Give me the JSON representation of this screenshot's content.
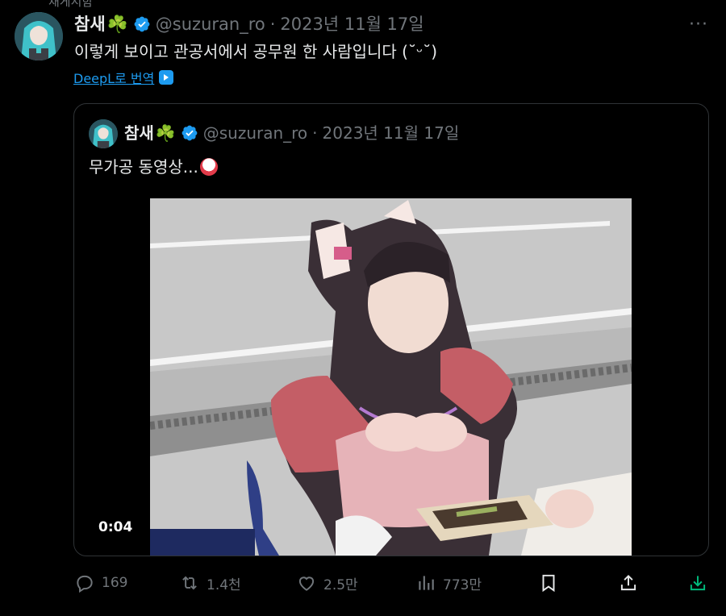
{
  "context_label": "재게시함",
  "tweet": {
    "author_name": "참새",
    "clover": "☘️",
    "handle": "@suzuran_ro",
    "separator": "·",
    "date": "2023년 11월 17일",
    "more": "···",
    "text": "이렇게 보이고 관공서에서 공무원 한 사람입니다 (˘ᵕ˘)",
    "translate_label": "DeepL로 번역"
  },
  "quoted": {
    "author_name": "참새",
    "clover": "☘️",
    "handle": "@suzuran_ro",
    "separator": "·",
    "date": "2023년 11월 17일",
    "text": "무가공 동영상...",
    "video_duration": "0:04"
  },
  "actions": {
    "reply_count": "169",
    "retweet_count": "1.4천",
    "like_count": "2.5만",
    "view_count": "773만"
  },
  "colors": {
    "background": "#000000",
    "text": "#e7e9ea",
    "muted": "#71767b",
    "accent": "#1d9bf0",
    "download": "#00ba7c",
    "border": "#2f3336"
  },
  "icons": [
    "verified-badge-icon",
    "more-icon",
    "deepl-icon",
    "reply-icon",
    "retweet-icon",
    "like-icon",
    "views-icon",
    "bookmark-icon",
    "share-icon",
    "download-icon"
  ]
}
